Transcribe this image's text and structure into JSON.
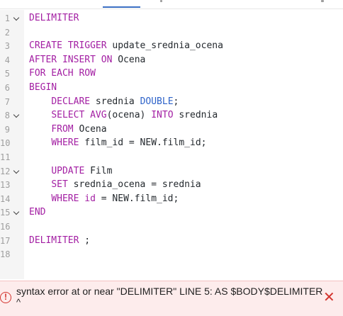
{
  "editor": {
    "lines": [
      {
        "no": "1",
        "fold": true,
        "tokens": [
          {
            "t": "DELIMITER",
            "c": "kw"
          }
        ]
      },
      {
        "no": "2",
        "fold": false,
        "tokens": []
      },
      {
        "no": "3",
        "fold": false,
        "tokens": [
          {
            "t": "CREATE TRIGGER",
            "c": "kw"
          },
          {
            "t": " update_srednia_ocena",
            "c": ""
          }
        ]
      },
      {
        "no": "4",
        "fold": false,
        "tokens": [
          {
            "t": "AFTER INSERT ON",
            "c": "kw"
          },
          {
            "t": " Ocena",
            "c": ""
          }
        ]
      },
      {
        "no": "5",
        "fold": false,
        "tokens": [
          {
            "t": "FOR EACH ROW",
            "c": "kw"
          }
        ]
      },
      {
        "no": "6",
        "fold": false,
        "tokens": [
          {
            "t": "BEGIN",
            "c": "kw"
          }
        ]
      },
      {
        "no": "7",
        "fold": false,
        "tokens": [
          {
            "t": "    ",
            "c": ""
          },
          {
            "t": "DECLARE",
            "c": "kw"
          },
          {
            "t": " srednia ",
            "c": ""
          },
          {
            "t": "DOUBLE",
            "c": "ty"
          },
          {
            "t": ";",
            "c": ""
          }
        ]
      },
      {
        "no": "8",
        "fold": true,
        "tokens": [
          {
            "t": "    ",
            "c": ""
          },
          {
            "t": "SELECT AVG",
            "c": "kw"
          },
          {
            "t": "(ocena) ",
            "c": ""
          },
          {
            "t": "INTO",
            "c": "kw"
          },
          {
            "t": " srednia",
            "c": ""
          }
        ]
      },
      {
        "no": "9",
        "fold": false,
        "tokens": [
          {
            "t": "    ",
            "c": ""
          },
          {
            "t": "FROM",
            "c": "kw"
          },
          {
            "t": " Ocena",
            "c": ""
          }
        ]
      },
      {
        "no": "10",
        "fold": false,
        "tokens": [
          {
            "t": "    ",
            "c": ""
          },
          {
            "t": "WHERE",
            "c": "kw"
          },
          {
            "t": " film_id = NEW.film_id;",
            "c": ""
          }
        ]
      },
      {
        "no": "11",
        "fold": false,
        "tokens": []
      },
      {
        "no": "12",
        "fold": true,
        "tokens": [
          {
            "t": "    ",
            "c": ""
          },
          {
            "t": "UPDATE",
            "c": "kw"
          },
          {
            "t": " Film",
            "c": ""
          }
        ]
      },
      {
        "no": "13",
        "fold": false,
        "tokens": [
          {
            "t": "    ",
            "c": ""
          },
          {
            "t": "SET",
            "c": "kw"
          },
          {
            "t": " srednia_ocena = srednia",
            "c": ""
          }
        ]
      },
      {
        "no": "14",
        "fold": false,
        "tokens": [
          {
            "t": "    ",
            "c": ""
          },
          {
            "t": "WHERE",
            "c": "kw"
          },
          {
            "t": " ",
            "c": ""
          },
          {
            "t": "id",
            "c": "kw"
          },
          {
            "t": " = NEW.film_id;",
            "c": ""
          }
        ]
      },
      {
        "no": "15",
        "fold": true,
        "tokens": [
          {
            "t": "END",
            "c": "kw"
          }
        ]
      },
      {
        "no": "16",
        "fold": false,
        "tokens": []
      },
      {
        "no": "17",
        "fold": false,
        "tokens": [
          {
            "t": "DELIMITER",
            "c": "kw"
          },
          {
            "t": " ;",
            "c": ""
          }
        ]
      },
      {
        "no": "18",
        "fold": false,
        "tokens": []
      }
    ]
  },
  "error": {
    "icon": "error-circle-icon",
    "icon_glyph": "!",
    "message": "syntax error at or near \"DELIMITER\" LINE 5: AS $BODY$DELIMITER",
    "caret": "^",
    "close_glyph": "✕"
  },
  "colors": {
    "keyword": "#a31fa3",
    "type": "#2e63c9",
    "error": "#d3342e",
    "error_bg": "#fdecec"
  }
}
